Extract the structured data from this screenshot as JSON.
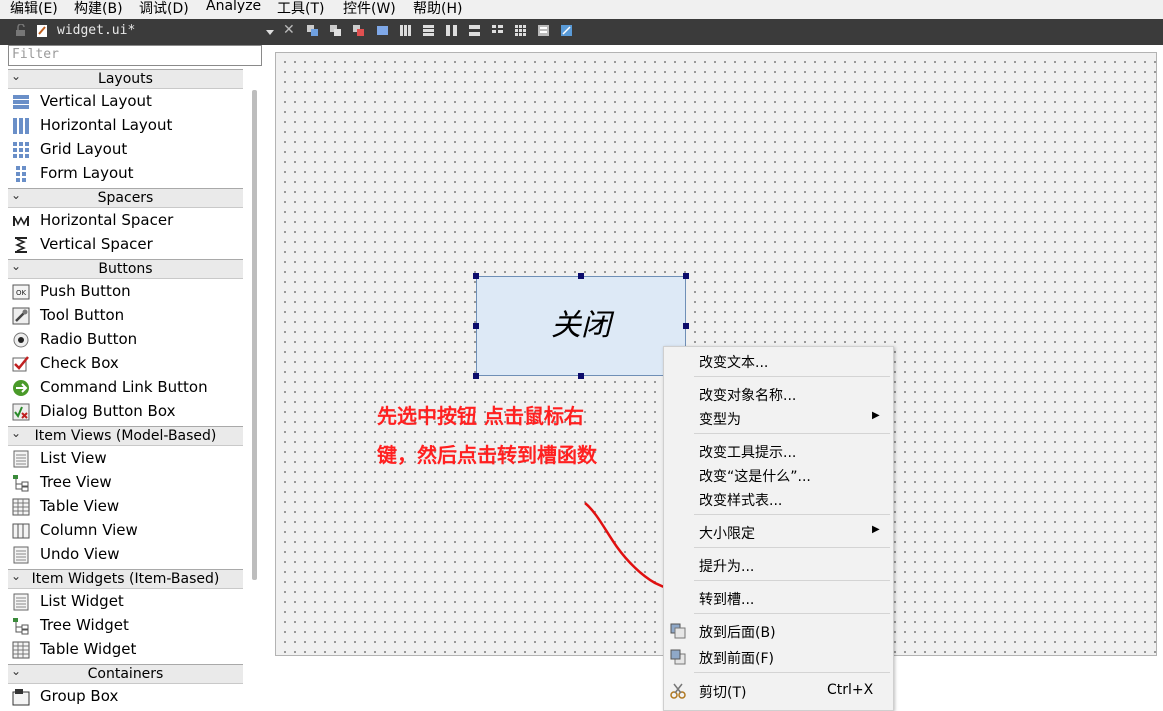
{
  "menubar": {
    "items": [
      "编辑(E)",
      "构建(B)",
      "调试(D)",
      "Analyze",
      "工具(T)",
      "控件(W)",
      "帮助(H)"
    ]
  },
  "editor_tab": {
    "title": "widget.ui*"
  },
  "widget_box": {
    "filter_placeholder": "Filter",
    "categories": {
      "layouts": {
        "label": "Layouts",
        "items": [
          "Vertical Layout",
          "Horizontal Layout",
          "Grid Layout",
          "Form Layout"
        ]
      },
      "spacers": {
        "label": "Spacers",
        "items": [
          "Horizontal Spacer",
          "Vertical Spacer"
        ]
      },
      "buttons": {
        "label": "Buttons",
        "items": [
          "Push Button",
          "Tool Button",
          "Radio Button",
          "Check Box",
          "Command Link Button",
          "Dialog Button Box"
        ]
      },
      "item_views": {
        "label": "Item Views (Model-Based)",
        "items": [
          "List View",
          "Tree View",
          "Table View",
          "Column View",
          "Undo View"
        ]
      },
      "item_widgets": {
        "label": "Item Widgets (Item-Based)",
        "items": [
          "List Widget",
          "Tree Widget",
          "Table Widget"
        ]
      },
      "containers": {
        "label": "Containers",
        "items": [
          "Group Box"
        ]
      }
    }
  },
  "form": {
    "button_text": "关闭"
  },
  "context_menu": {
    "change_text": "改变文本...",
    "change_object_name": "改变对象名称...",
    "morph_into": "变型为",
    "change_tooltip": "改变工具提示...",
    "change_whats_this": "改变“这是什么”...",
    "change_stylesheet": "改变样式表...",
    "size_constraints": "大小限定",
    "promote_to": "提升为...",
    "go_to_slot": "转到槽...",
    "send_to_back": "放到后面(B)",
    "bring_to_front": "放到前面(F)",
    "cut": "剪切(T)",
    "cut_shortcut": "Ctrl+X"
  },
  "annotation": {
    "line1": "先选中按钮 点击鼠标右",
    "line2": "键，然后点击转到槽函数"
  },
  "colors": {
    "annotation": "#ff2020",
    "toolbar_bg": "#3b3b3b",
    "selection_handle": "#0b0b6b",
    "button_fill": "#dde9f6"
  }
}
